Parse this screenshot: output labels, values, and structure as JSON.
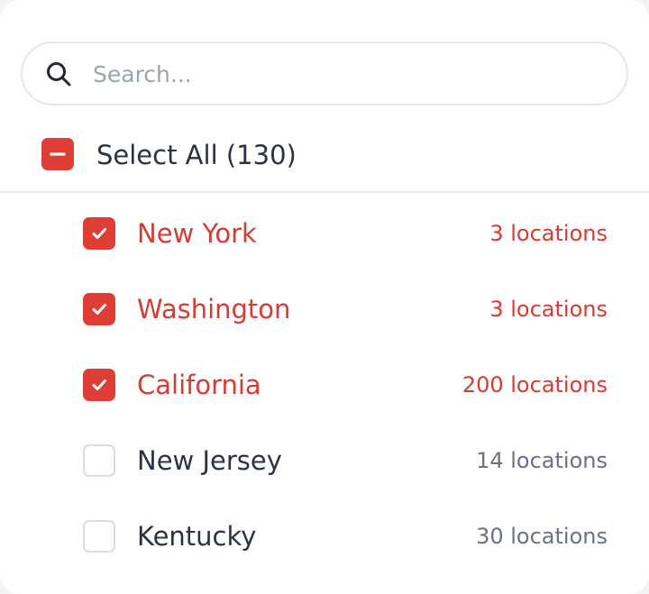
{
  "search": {
    "placeholder": "Search...",
    "icon": "search-icon"
  },
  "select_all": {
    "label": "Select All (130)",
    "state": "indeterminate"
  },
  "items": [
    {
      "label": "New York",
      "count": "3 locations",
      "checked": true
    },
    {
      "label": "Washington",
      "count": "3 locations",
      "checked": true
    },
    {
      "label": "California",
      "count": "200 locations",
      "checked": true
    },
    {
      "label": "New Jersey",
      "count": "14 locations",
      "checked": false
    },
    {
      "label": "Kentucky",
      "count": "30 locations",
      "checked": false
    }
  ],
  "colors": {
    "accent": "#df3e36",
    "text": "#2b3340",
    "muted": "#6b7280",
    "border": "#e5e7eb"
  }
}
